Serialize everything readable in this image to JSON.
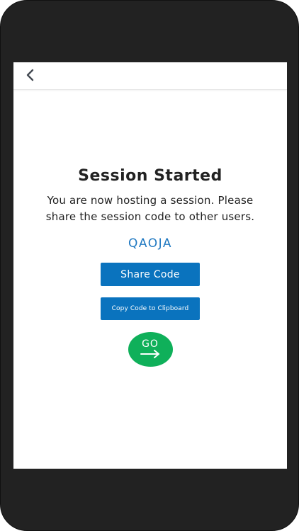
{
  "header": {
    "back_icon": "chevron-left-icon"
  },
  "session": {
    "title": "Session Started",
    "message": "You are now hosting a session. Please share the session code to other users.",
    "code": "QAOJA",
    "share_label": "Share Code",
    "copy_label": "Copy Code to Clipboard",
    "go_label": "GO",
    "go_icon": "arrow-right-icon"
  },
  "colors": {
    "accent_blue": "#0a73be",
    "code_blue": "#1f78c1",
    "go_green": "#0fb05a",
    "device_frame": "#222222"
  }
}
